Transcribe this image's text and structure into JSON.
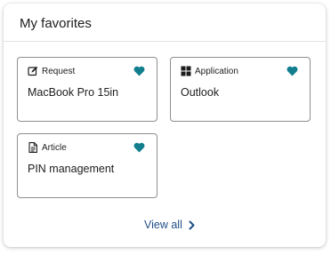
{
  "panel": {
    "title": "My favorites",
    "view_all_label": "View all"
  },
  "cards": [
    {
      "type_label": "Request",
      "type_icon": "edit-icon",
      "title": "MacBook Pro 15in",
      "favorited": true
    },
    {
      "type_label": "Application",
      "type_icon": "grid-icon",
      "title": "Outlook",
      "favorited": true
    },
    {
      "type_label": "Article",
      "type_icon": "document-icon",
      "title": "PIN management",
      "favorited": true
    }
  ],
  "colors": {
    "heart": "#127e8e",
    "link": "#1f4f86",
    "card_border": "#8f8f8f"
  }
}
